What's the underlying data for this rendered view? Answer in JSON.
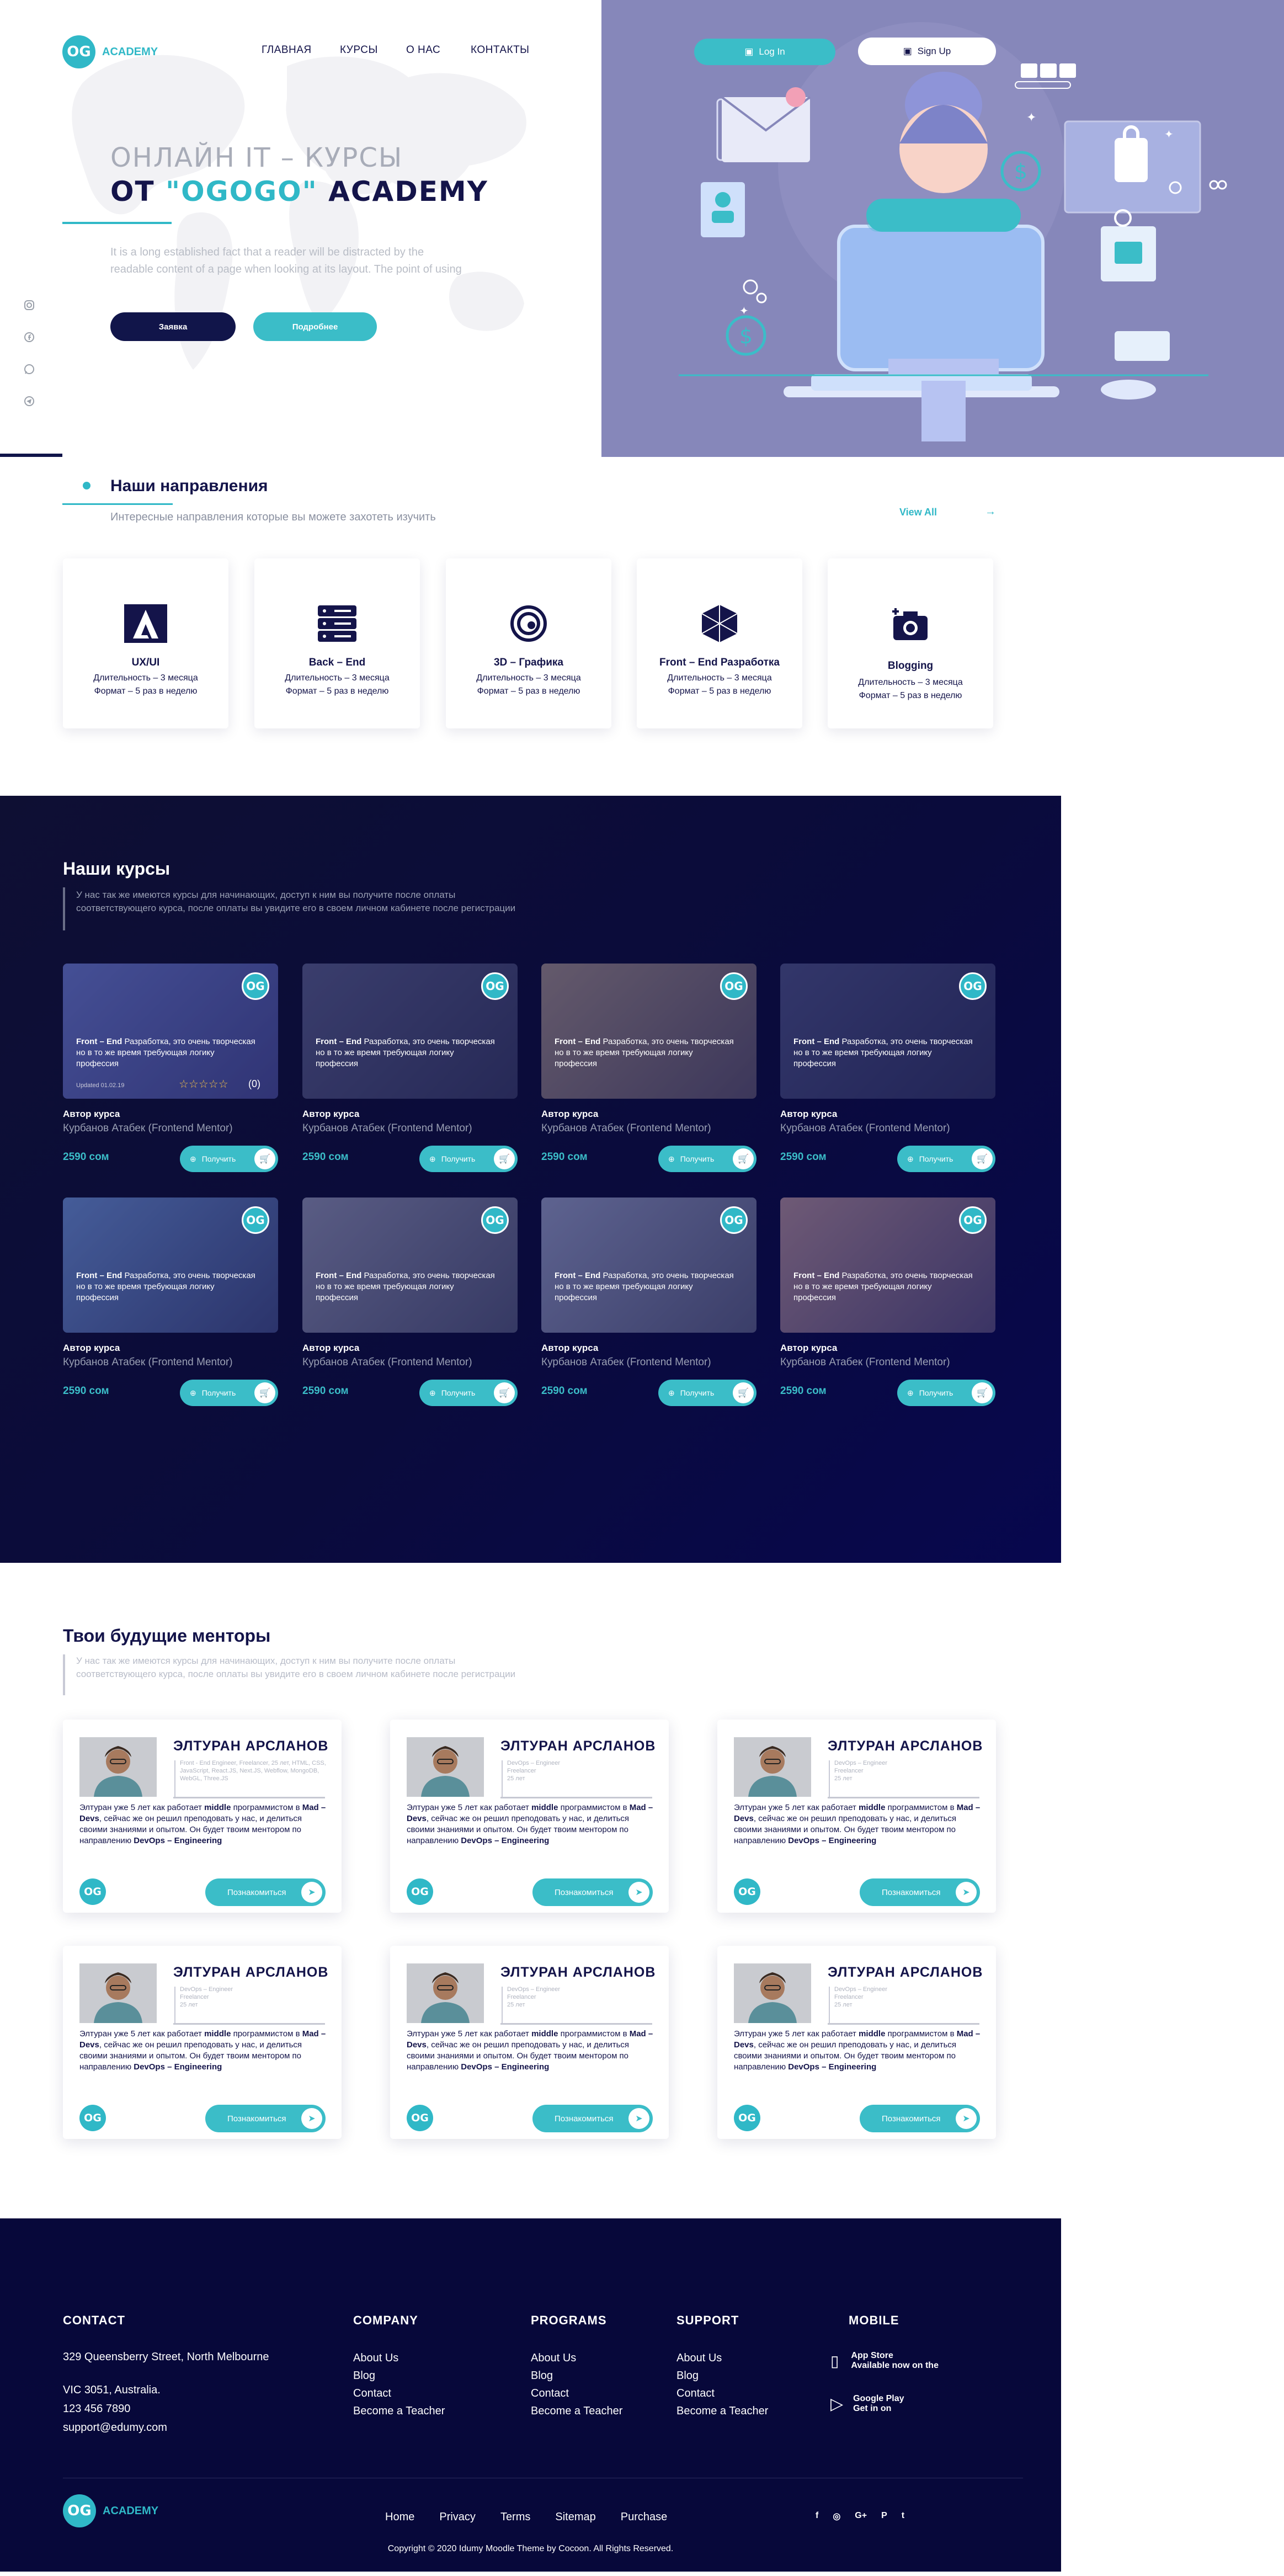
{
  "brand": {
    "logo_mark": "OG",
    "name": "ACADEMY"
  },
  "nav": [
    "ГЛАВНАЯ",
    "КУРСЫ",
    "О НАС",
    "КОНТАКТЫ"
  ],
  "auth": {
    "login": "Log In",
    "signup": "Sign Up"
  },
  "hero": {
    "title_line1": "ОНЛАЙН IT – КУРСЫ",
    "title_pre": "ОТ ",
    "title_og": "\"OGOGO\"",
    "title_post": " ACADEMY",
    "description": "It is a long established fact that a reader will be distracted by the readable content of a page when looking at its layout. The point of using",
    "btn_request": "Заявка",
    "btn_more": "Подробнее"
  },
  "social_vertical": [
    "instagram-icon",
    "facebook-icon",
    "whatsapp-icon",
    "telegram-icon"
  ],
  "directions": {
    "title": "Наши направления",
    "subtitle": "Интересные направления которые вы можете захотеть изучить",
    "view_all": "View All",
    "items": [
      {
        "name": "UX/UI",
        "duration": "Длительность – 3 месяца",
        "format": "Формат – 5 раз в неделю",
        "icon": "adobe-icon"
      },
      {
        "name": "Back – End",
        "duration": "Длительность – 3 месяца",
        "format": "Формат – 5 раз в неделю",
        "icon": "server-icon"
      },
      {
        "name": "3D – Графика",
        "duration": "Длительность – 3 месяца",
        "format": "Формат – 5 раз в неделю",
        "icon": "swirl-icon"
      },
      {
        "name": "Front – End Разработка",
        "duration": "Длительность – 3 месяца",
        "format": "Формат – 5 раз в неделю",
        "icon": "cube-icon"
      },
      {
        "name": "Blogging",
        "duration": "Длительность – 3 месяца",
        "format": "Формат – 5 раз в неделю",
        "icon": "camera-icon"
      }
    ]
  },
  "courses": {
    "title": "Наши курсы",
    "description": "У нас так же имеются курсы для начинающих, доступ к ним вы получите после оплаты соответствующего курса, после оплаты вы увидите его в своем личном кабинете после регистрации",
    "logo_mark": "OG",
    "caption_bold": "Front – End",
    "caption_rest": " Разработка, это очень творческая но в то же время требующая логику профессия",
    "updated": "Updated 01.02.19",
    "stars": "☆☆☆☆☆",
    "rating_count": "(0)",
    "author_label": "Автор курса",
    "mentor": "Курбанов Атабек (Frontend Mentor)",
    "price": "2590 сом",
    "get_label": "Получить",
    "count": 8
  },
  "mentors": {
    "title": "Твои будущие менторы",
    "description": "У нас так же имеются курсы для начинающих, доступ к ним вы получите после оплаты соответствующего курса, после оплаты вы увидите его в своем личном кабинете после регистрации",
    "name": "ЭЛТУРАН АРСЛАНОВ",
    "tags_first": "Front - End Engineer, Freelancer, 25 лет, HTML, CSS, JavaScript, React.JS, Next.JS, Webflow, MongoDB, WebGL, Three.JS",
    "tags": "DevOps – Engineer\nFreelancer\n25 лет",
    "bio_pre": "Элтуран уже 5 лет как  работает ",
    "bio_b1": "middle",
    "bio_mid": " программистом в ",
    "bio_b2": "Mad – Devs",
    "bio_mid2": ", сейчас же он решил преподовать у нас, и делиться своими знаниями и опытом. Он будет твоим ментором по направлению ",
    "bio_b3": "DevOps – Engineering",
    "logo_mark": "OG",
    "button": "Познакомиться"
  },
  "footer": {
    "contact": {
      "title": "CONTACT",
      "address1": "329 Queensberry Street, North Melbourne",
      "address2": "VIC 3051, Australia.",
      "phone": "123 456 7890",
      "email": "support@edumy.com"
    },
    "columns": [
      {
        "title": "COMPANY",
        "links": [
          "About Us",
          "Blog",
          "Contact",
          "Become a Teacher"
        ]
      },
      {
        "title": "PROGRAMS",
        "links": [
          "About Us",
          "Blog",
          "Contact",
          "Become a Teacher"
        ]
      },
      {
        "title": "SUPPORT",
        "links": [
          "About Us",
          "Blog",
          "Contact",
          "Become a Teacher"
        ]
      }
    ],
    "mobile": {
      "title": "MOBILE",
      "app_store_1": "App Store",
      "app_store_2": "Available now on the",
      "google_1": "Google Play",
      "google_2": "Get in on"
    },
    "bottom_links": [
      "Home",
      "Privacy",
      "Terms",
      "Sitemap",
      "Purchase"
    ],
    "social": [
      "facebook-icon",
      "instagram-icon",
      "google-plus-icon",
      "pinterest-icon",
      "twitter-icon"
    ],
    "social_glyphs": [
      "f",
      "◎",
      "G+",
      "P",
      "t"
    ],
    "copyright": "Copyright © 2020 Idumy Moodle Theme by Cocoon. All Rights Reserved."
  },
  "colors": {
    "navy": "#14144a",
    "teal": "#30b8c7",
    "hero_purple": "#8687ba",
    "courses_bg": "#0a0b3c"
  }
}
